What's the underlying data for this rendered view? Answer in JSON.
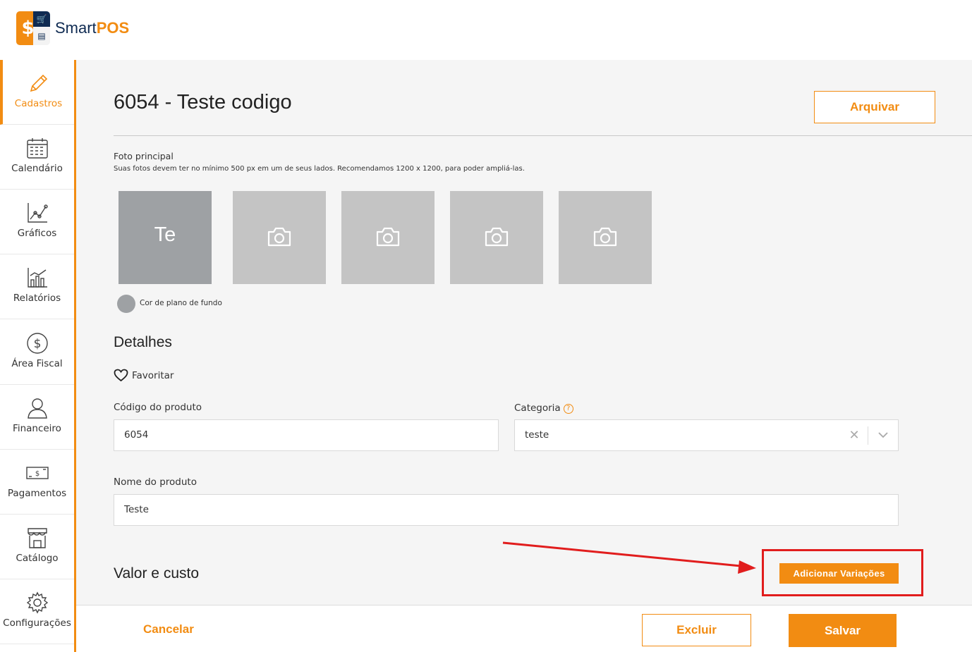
{
  "brand": {
    "name_part1": "Smart",
    "name_part2": "POS"
  },
  "sidebar": {
    "items": [
      {
        "label": "Cadastros",
        "icon": "pencil-icon",
        "active": true
      },
      {
        "label": "Calendário",
        "icon": "calendar-icon"
      },
      {
        "label": "Gráficos",
        "icon": "line-chart-icon"
      },
      {
        "label": "Relatórios",
        "icon": "bar-chart-icon"
      },
      {
        "label": "Área Fiscal",
        "icon": "dollar-circle-icon"
      },
      {
        "label": "Financeiro",
        "icon": "user-icon"
      },
      {
        "label": "Pagamentos",
        "icon": "banknote-icon"
      },
      {
        "label": "Catálogo",
        "icon": "store-icon"
      },
      {
        "label": "Configurações",
        "icon": "gear-icon"
      }
    ]
  },
  "page": {
    "title": "6054 - Teste codigo",
    "archive_label": "Arquivar"
  },
  "photos": {
    "label": "Foto principal",
    "hint": "Suas fotos devem ter no mínimo 500 px em um de seus lados. Recomendamos 1200 x 1200, para poder ampliá-las.",
    "main_initials": "Te",
    "bg_color_label": "Cor de plano de fundo",
    "bg_color": "#9ea1a4"
  },
  "details": {
    "title": "Detalhes",
    "favorite_label": "Favoritar",
    "code_label": "Código do produto",
    "code_value": "6054",
    "category_label": "Categoria",
    "category_value": "teste",
    "name_label": "Nome do produto",
    "name_value": "Teste"
  },
  "value_section": {
    "title": "Valor e custo",
    "add_variations_label": "Adicionar Variações"
  },
  "footer": {
    "cancel_label": "Cancelar",
    "delete_label": "Excluir",
    "save_label": "Salvar"
  },
  "colors": {
    "accent": "#f28c12",
    "annotation": "#e11d1d",
    "brand_dark": "#0f2b52"
  }
}
